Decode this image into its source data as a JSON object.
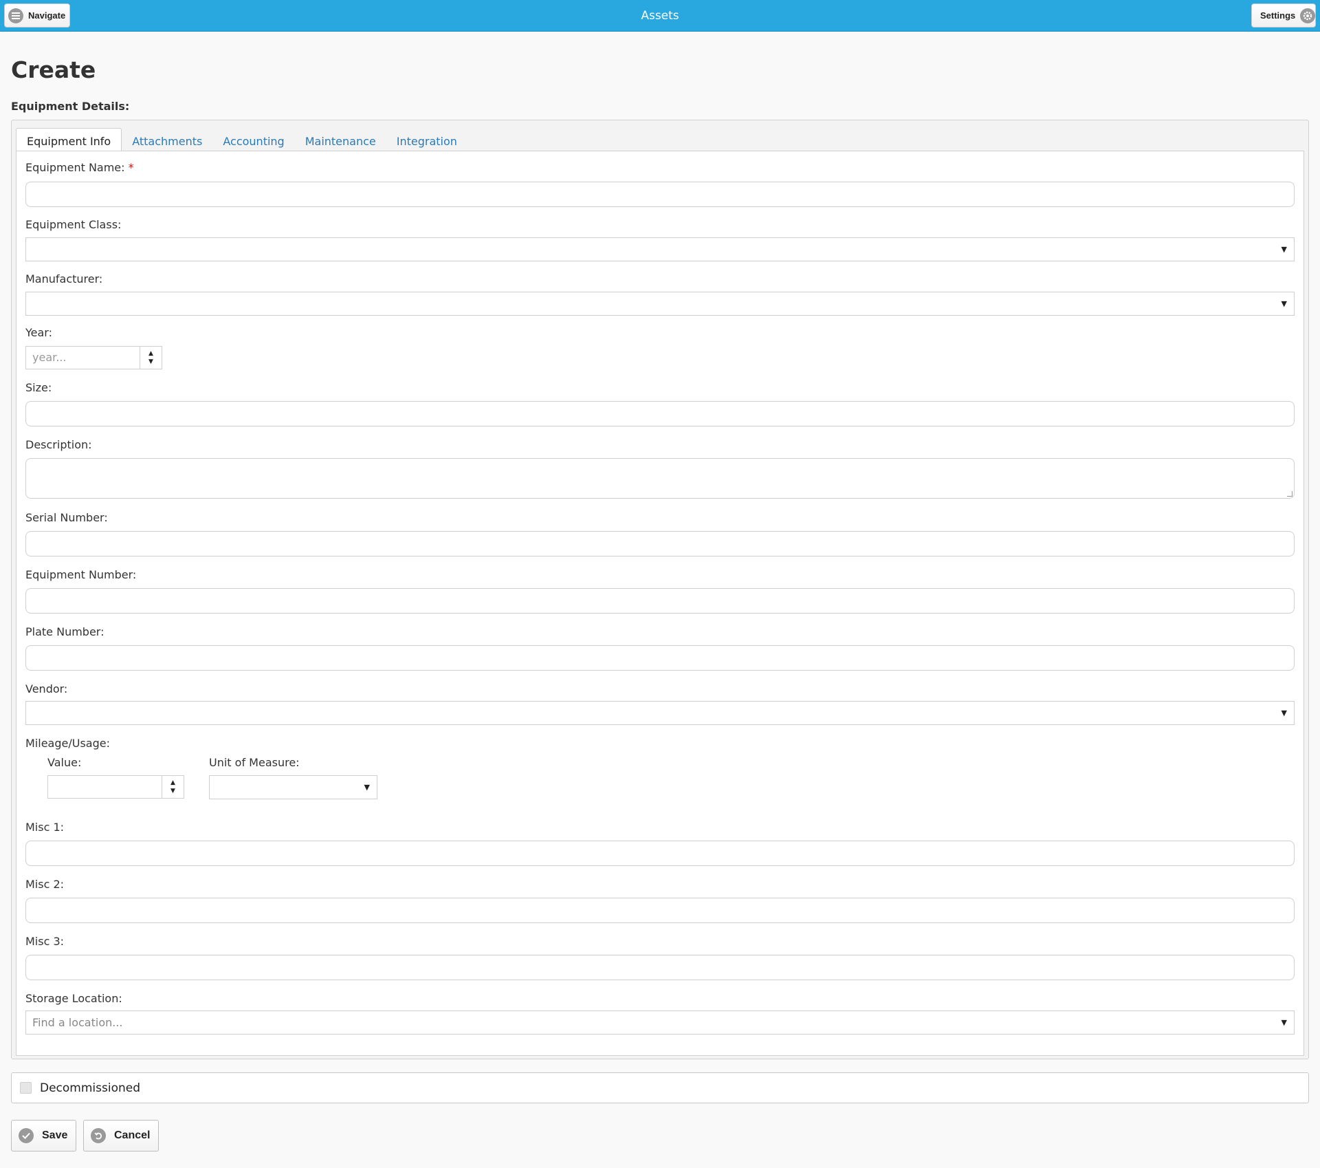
{
  "header": {
    "title": "Assets",
    "navigate_label": "Navigate",
    "settings_label": "Settings"
  },
  "page": {
    "title": "Create",
    "section_label": "Equipment Details:"
  },
  "tabs": [
    {
      "label": "Equipment Info",
      "active": true
    },
    {
      "label": "Attachments",
      "active": false
    },
    {
      "label": "Accounting",
      "active": false
    },
    {
      "label": "Maintenance",
      "active": false
    },
    {
      "label": "Integration",
      "active": false
    }
  ],
  "fields": {
    "equipment_name": {
      "label": "Equipment Name:",
      "required_mark": "*",
      "value": ""
    },
    "equipment_class": {
      "label": "Equipment Class:",
      "value": ""
    },
    "manufacturer": {
      "label": "Manufacturer:",
      "value": ""
    },
    "year": {
      "label": "Year:",
      "placeholder": "year..."
    },
    "size": {
      "label": "Size:",
      "value": ""
    },
    "description": {
      "label": "Description:",
      "value": ""
    },
    "serial_number": {
      "label": "Serial Number:",
      "value": ""
    },
    "equipment_number": {
      "label": "Equipment Number:",
      "value": ""
    },
    "plate_number": {
      "label": "Plate Number:",
      "value": ""
    },
    "vendor": {
      "label": "Vendor:",
      "value": ""
    },
    "mileage": {
      "label": "Mileage/Usage:",
      "value_label": "Value:",
      "unit_label": "Unit of Measure:"
    },
    "misc1": {
      "label": "Misc 1:",
      "value": ""
    },
    "misc2": {
      "label": "Misc 2:",
      "value": ""
    },
    "misc3": {
      "label": "Misc 3:",
      "value": ""
    },
    "storage_location": {
      "label": "Storage Location:",
      "placeholder": "Find a location..."
    }
  },
  "decommissioned": {
    "label": "Decommissioned",
    "checked": false
  },
  "actions": {
    "save_label": "Save",
    "cancel_label": "Cancel"
  },
  "colors": {
    "header_bg": "#29a8e0",
    "tab_link": "#2a7ab8",
    "required": "#dd1111"
  },
  "icons": {
    "navigate": "menu-icon",
    "settings": "gear-icon",
    "save": "check-icon",
    "cancel": "undo-icon"
  }
}
